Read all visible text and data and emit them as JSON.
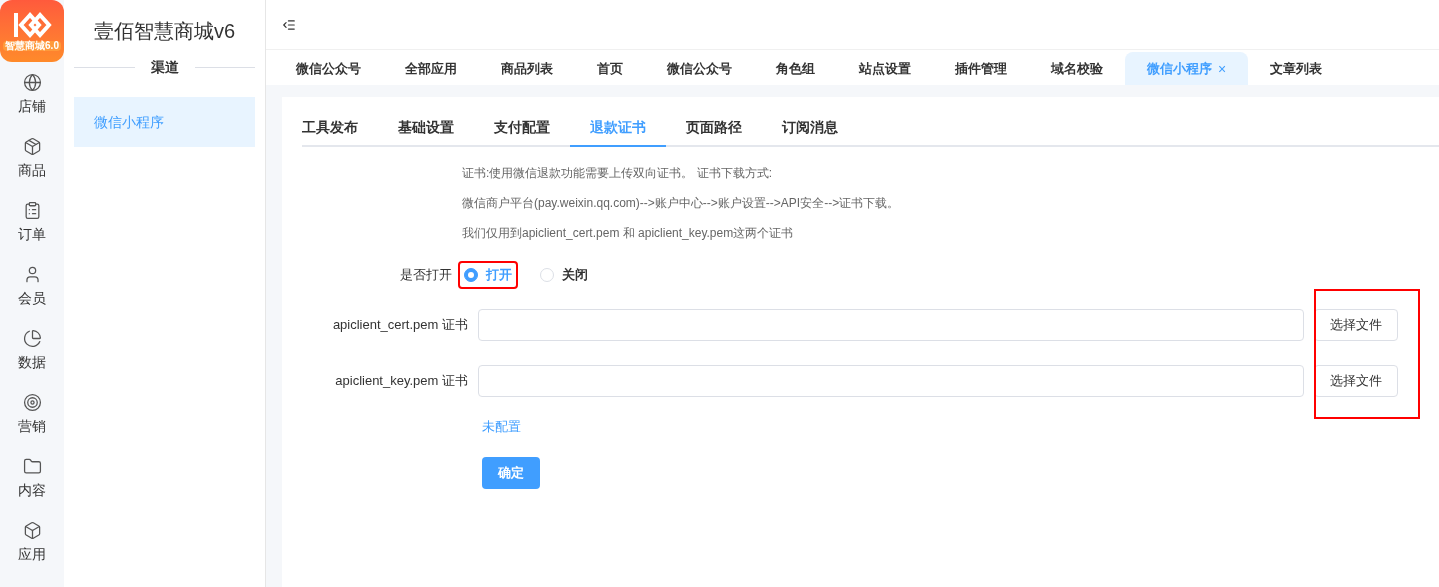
{
  "logo": {
    "caption": "智慧商城6.0"
  },
  "nav": [
    {
      "label": "店铺"
    },
    {
      "label": "商品"
    },
    {
      "label": "订单"
    },
    {
      "label": "会员"
    },
    {
      "label": "数据"
    },
    {
      "label": "营销"
    },
    {
      "label": "内容"
    },
    {
      "label": "应用"
    }
  ],
  "sidebar": {
    "title": "壹佰智慧商城v6",
    "section": "渠道",
    "items": [
      {
        "label": "微信小程序",
        "selected": true
      }
    ]
  },
  "tabs": [
    {
      "label": "微信公众号",
      "selected": false
    },
    {
      "label": "全部应用",
      "selected": false
    },
    {
      "label": "商品列表",
      "selected": false
    },
    {
      "label": "首页",
      "selected": false
    },
    {
      "label": "微信公众号",
      "selected": false
    },
    {
      "label": "角色组",
      "selected": false
    },
    {
      "label": "站点设置",
      "selected": false
    },
    {
      "label": "插件管理",
      "selected": false
    },
    {
      "label": "域名校验",
      "selected": false
    },
    {
      "label": "微信小程序",
      "selected": true,
      "close": "×"
    },
    {
      "label": "文章列表",
      "selected": false
    }
  ],
  "subtabs": [
    {
      "label": "工具发布",
      "selected": false
    },
    {
      "label": "基础设置",
      "selected": false
    },
    {
      "label": "支付配置",
      "selected": false
    },
    {
      "label": "退款证书",
      "selected": true
    },
    {
      "label": "页面路径",
      "selected": false
    },
    {
      "label": "订阅消息",
      "selected": false
    }
  ],
  "notes": [
    "证书:使用微信退款功能需要上传双向证书。 证书下载方式:",
    "微信商户平台(pay.weixin.qq.com)-->账户中心-->账户设置-->API安全-->证书下载。",
    "我们仅用到apiclient_cert.pem 和 apiclient_key.pem这两个证书"
  ],
  "enable": {
    "label": "是否打开",
    "options": [
      {
        "label": "打开",
        "selected": true
      },
      {
        "label": "关闭",
        "selected": false
      }
    ]
  },
  "files": [
    {
      "label": "apiclient_cert.pem 证书",
      "button": "选择文件"
    },
    {
      "label": "apiclient_key.pem 证书",
      "button": "选择文件"
    }
  ],
  "status": "未配置",
  "submit": "确定"
}
